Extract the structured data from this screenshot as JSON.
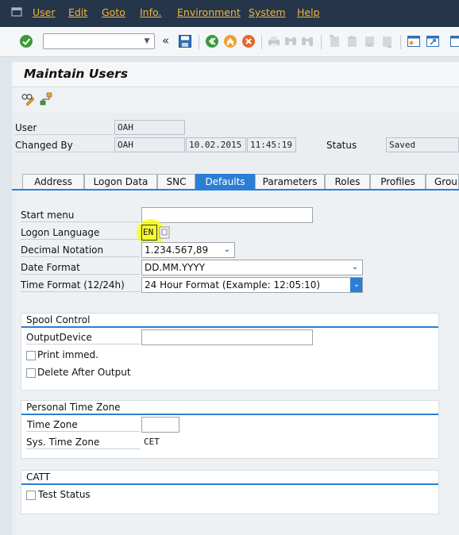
{
  "menu": {
    "items": [
      "User",
      "Edit",
      "Goto",
      "Info.",
      "Environment",
      "System",
      "Help"
    ]
  },
  "toolbar": {
    "icons": [
      "enter-icon",
      "save-icon",
      "back-icon",
      "exit-icon",
      "cancel-icon",
      "print-icon",
      "find-icon",
      "find-next-icon",
      "first-page-icon",
      "previous-page-icon",
      "next-page-icon",
      "last-page-icon",
      "create-session-icon",
      "shortcut-icon"
    ],
    "collapse_glyph": "«"
  },
  "title": {
    "text": "Maintain Users"
  },
  "header": {
    "user_label": "User",
    "user_value": "OAH",
    "changed_by_label": "Changed By",
    "changed_by_value": "OAH",
    "date_value": "10.02.2015",
    "time_value": "11:45:19",
    "status_label": "Status",
    "status_value": "Saved"
  },
  "tabs": [
    {
      "label": "Address",
      "active": false
    },
    {
      "label": "Logon Data",
      "active": false
    },
    {
      "label": "SNC",
      "active": false
    },
    {
      "label": "Defaults",
      "active": true
    },
    {
      "label": "Parameters",
      "active": false
    },
    {
      "label": "Roles",
      "active": false
    },
    {
      "label": "Profiles",
      "active": false
    },
    {
      "label": "Groups",
      "active": false
    }
  ],
  "defaults": {
    "start_menu_label": "Start menu",
    "start_menu_value": "",
    "logon_language_label": "Logon Language",
    "logon_language_value": "EN",
    "decimal_notation_label": "Decimal Notation",
    "decimal_notation_value": "1.234.567,89",
    "date_format_label": "Date Format",
    "date_format_value": "DD.MM.YYYY",
    "time_format_label": "Time Format (12/24h)",
    "time_format_value": "24 Hour Format (Example: 12:05:10)"
  },
  "spool": {
    "title": "Spool Control",
    "output_device_label": "OutputDevice",
    "output_device_value": "",
    "print_immed_label": "Print immed.",
    "delete_after_output_label": "Delete After Output"
  },
  "timezone": {
    "title": "Personal Time Zone",
    "time_zone_label": "Time Zone",
    "time_zone_value": "",
    "sys_time_zone_label": "Sys. Time Zone",
    "sys_time_zone_value": "CET"
  },
  "catt": {
    "title": "CATT",
    "test_status_label": "Test Status"
  },
  "colors": {
    "menu_bg": "#25364a",
    "menu_text": "#f2b43c",
    "accent": "#2a7fd4",
    "highlight": "#ffff00"
  }
}
